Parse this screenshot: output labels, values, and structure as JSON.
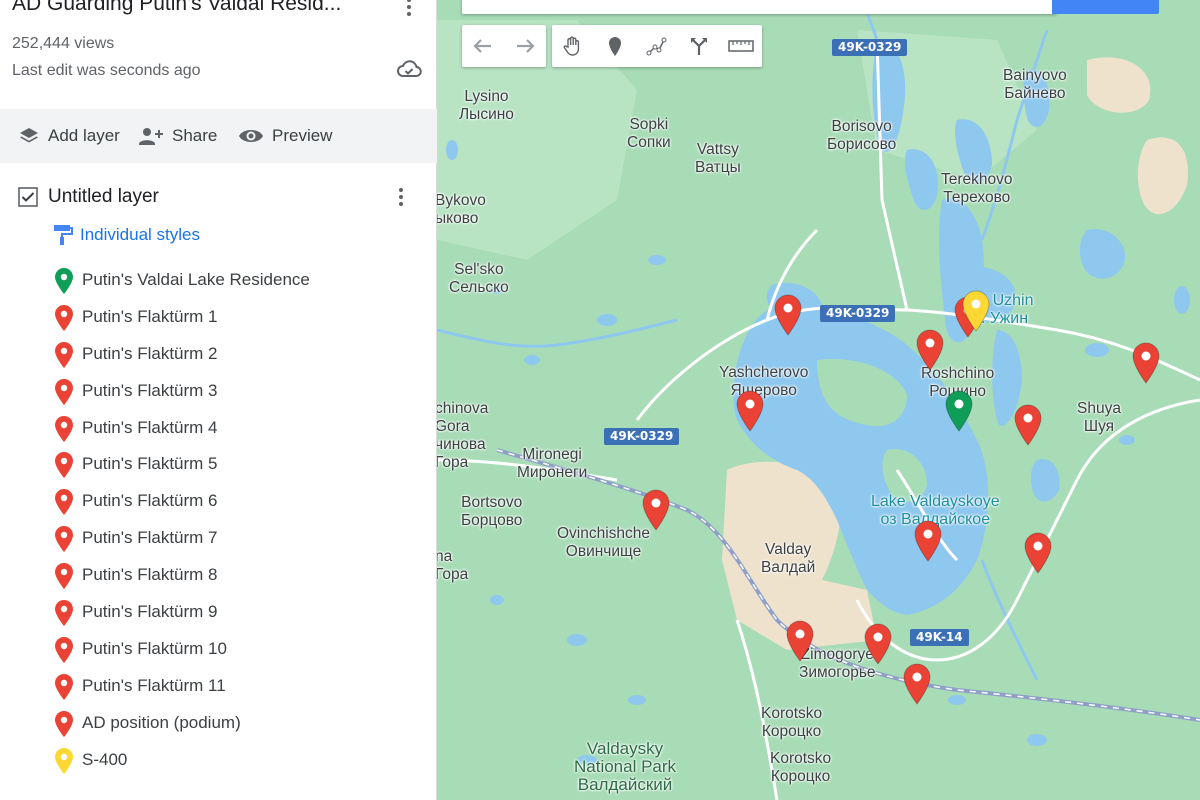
{
  "map_title": "AD Guarding Putin's Valdai Resid...",
  "views": "252,444 views",
  "last_edit": "Last edit was seconds ago",
  "toolbar": {
    "add_layer": "Add layer",
    "share": "Share",
    "preview": "Preview"
  },
  "layer": {
    "name": "Untitled layer",
    "checked": true,
    "styles_label": "Individual styles"
  },
  "places": [
    {
      "label": "Putin's Valdai Lake Residence",
      "color": "#0f9d58"
    },
    {
      "label": "Putin's Flaktürm 1",
      "color": "#ea4335"
    },
    {
      "label": "Putin's Flaktürm 2",
      "color": "#ea4335"
    },
    {
      "label": "Putin's Flaktürm 3",
      "color": "#ea4335"
    },
    {
      "label": "Putin's Flaktürm 4",
      "color": "#ea4335"
    },
    {
      "label": "Putin's Flaktürm 5",
      "color": "#ea4335"
    },
    {
      "label": "Putin's Flaktürm 6",
      "color": "#ea4335"
    },
    {
      "label": "Putin's Flaktürm 7",
      "color": "#ea4335"
    },
    {
      "label": "Putin's Flaktürm 8",
      "color": "#ea4335"
    },
    {
      "label": "Putin's Flaktürm 9",
      "color": "#ea4335"
    },
    {
      "label": "Putin's Flaktürm 10",
      "color": "#ea4335"
    },
    {
      "label": "Putin's Flaktürm 11",
      "color": "#ea4335"
    },
    {
      "label": "AD position (podium)",
      "color": "#ea4335"
    },
    {
      "label": "S-400",
      "color": "#fdd835"
    }
  ],
  "map_labels": {
    "lysino": "Lysino\nЛысино",
    "sopki": "Sopki\nСопки",
    "vattsy": "Vattsy\nВатцы",
    "borisovo": "Borisovo\nБорисово",
    "bainyovo": "Bainyovo\nБайнево",
    "terekhovo": "Terekhovo\nТерехово",
    "bykovo": "Bykovo\nыково",
    "selsko": "Sel'sko\nСельско",
    "ozero_uzhin": "ero Uzhin\nоз. Ужин",
    "roshchino": "Roshchino\nРощино",
    "yashcherovo": "Yashcherovo\nЯщерово",
    "shuya": "Shuya\nШуя",
    "chinova": "chinova\nGora\nчинова\nГора",
    "mironegi": "Mironegi\nМиронеги",
    "bortsovo": "Bortsovo\nБорцово",
    "ovinchishche": "Ovinchishche\nОвинчище",
    "lake_valdayskoye": "Lake Valdayskoye\nоз Валдайское",
    "valday": "Valday\nВалдай",
    "na_gora": "na\nГора",
    "zimogorye": "Zimogorye\nЗимогорье",
    "korotsko_1": "Korotsko\nКороцко",
    "korotsko_2": "Korotsko\nКороцко",
    "valdaysky_park": "Valdaysky\nNational Park\nВалдайский"
  },
  "road_shields": [
    {
      "key": "r1",
      "text": "49K-0329"
    },
    {
      "key": "r2",
      "text": "49K-0329"
    },
    {
      "key": "r3",
      "text": "49K-0329"
    },
    {
      "key": "r4",
      "text": "49K-14"
    }
  ],
  "tools": [
    "undo-icon",
    "redo-icon",
    "hand-icon",
    "marker-icon",
    "draw-line-icon",
    "directions-icon",
    "ruler-icon"
  ],
  "colors": {
    "land": "#a8dcb7",
    "water": "#8fc8ee",
    "urban": "#efe2cc",
    "road": "#ffffff",
    "rail": "#8fa0c8"
  }
}
